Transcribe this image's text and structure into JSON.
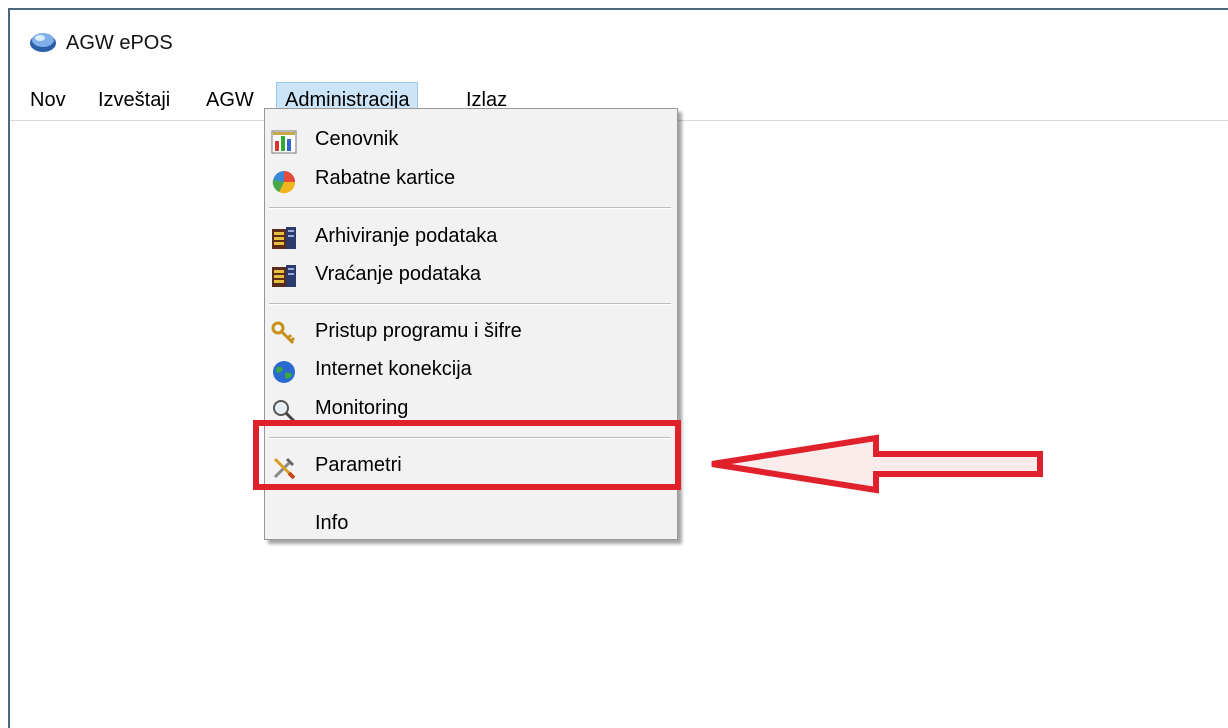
{
  "window": {
    "title": "AGW ePOS",
    "app_icon": "app-logo-icon"
  },
  "menubar": {
    "items": [
      {
        "label": "Nov"
      },
      {
        "label": "Izveštaji"
      },
      {
        "label": "AGW"
      },
      {
        "label": "Administracija",
        "active": true
      },
      {
        "label": "Izlaz"
      }
    ]
  },
  "dropdown": {
    "items": [
      {
        "label": "Cenovnik",
        "icon": "price-list-icon"
      },
      {
        "label": "Rabatne kartice",
        "icon": "discount-cards-icon"
      },
      {
        "label": "Arhiviranje podataka",
        "icon": "archive-icon"
      },
      {
        "label": "Vraćanje podataka",
        "icon": "restore-icon"
      },
      {
        "label": "Pristup programu i šifre",
        "icon": "keys-icon"
      },
      {
        "label": "Internet konekcija",
        "icon": "globe-icon"
      },
      {
        "label": "Monitoring",
        "icon": "magnifier-icon"
      },
      {
        "label": "Parametri",
        "icon": "tools-icon"
      },
      {
        "label": "Info",
        "icon": ""
      }
    ]
  },
  "annotation": {
    "highlight_color": "#e0202a",
    "arrow_color": "#e0202a",
    "target": "Parametri"
  }
}
